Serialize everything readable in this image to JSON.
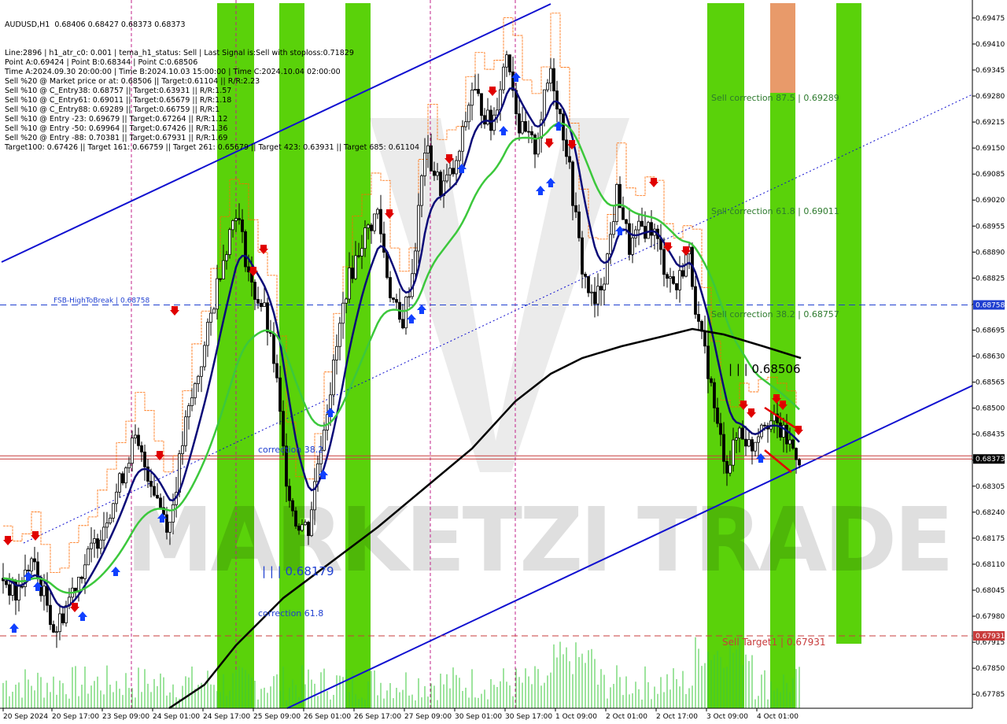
{
  "window": {
    "symbol_line": "AUDUSD,H1  0.68406 0.68427 0.68373 0.68373"
  },
  "info_lines": [
    "Line:2896 | h1_atr_c0: 0.001 | tema_h1_status: Sell | Last Signal is:Sell with stoploss:0.71829",
    "Point A:0.69424 | Point B:0.68344 | Point C:0.68506",
    "Time A:2024.09.30 20:00:00 | Time B:2024.10.03 15:00:00 | Time C:2024.10.04 02:00:00",
    "Sell %20 @ Market price or at: 0.68506 || Target:0.61104 || R/R:2.23",
    "Sell %10 @ C_Entry38: 0.68757 || Target:0.63931 || R/R:1.57",
    "Sell %10 @ C_Entry61: 0.69011 || Target:0.65679 || R/R:1.18",
    "Sell %10 @ C_Entry88: 0.69289 || Target:0.66759 || R/R:1",
    "Sell %10 @ Entry -23: 0.69679 || Target:0.67264 || R/R:1.12",
    "Sell %10 @ Entry -50: 0.69964 || Target:0.67426 || R/R:1.36",
    "Sell %20 @ Entry -88: 0.70381 || Target:0.67931 || R/R:1.69",
    "Target100: 0.67426 || Target 161: 0.66759 || Target 261: 0.65679 || Target 423: 0.63931 || Target 685: 0.61104"
  ],
  "chart_data": {
    "type": "candlestick",
    "symbol": "AUDUSD",
    "timeframe": "H1",
    "ylim": [
      0.6775,
      0.6952
    ],
    "y_ticks": [
      "0.69475",
      "0.69410",
      "0.69345",
      "0.69280",
      "0.69215",
      "0.69150",
      "0.69085",
      "0.69020",
      "0.68955",
      "0.68890",
      "0.68825",
      "0.68760",
      "0.68695",
      "0.68630",
      "0.68565",
      "0.68500",
      "0.68435",
      "0.68370",
      "0.68305",
      "0.68240",
      "0.68175",
      "0.68110",
      "0.68045",
      "0.67980",
      "0.67915",
      "0.67850",
      "0.67785"
    ],
    "x_ticks": [
      "20 Sep 2024",
      "20 Sep 17:00",
      "23 Sep 09:00",
      "24 Sep 01:00",
      "24 Sep 17:00",
      "25 Sep 09:00",
      "26 Sep 01:00",
      "26 Sep 17:00",
      "27 Sep 09:00",
      "30 Sep 01:00",
      "30 Sep 17:00",
      "1 Oct 09:00",
      "2 Oct 01:00",
      "2 Oct 17:00",
      "3 Oct 09:00",
      "4 Oct 01:00"
    ],
    "price_tags": [
      {
        "value": 0.68758,
        "label": "0.68758",
        "color": "#1f3fd0"
      },
      {
        "value": 0.68373,
        "label": "0.68373",
        "color": "#000000"
      },
      {
        "value": 0.67931,
        "label": "0.67931",
        "color": "#c83c3c"
      }
    ],
    "horizontal_levels": [
      {
        "name": "FSB-HighToBreak",
        "label": "FSB-HighToBreak | 0.68758",
        "value": 0.68758,
        "color": "#1f3fd0",
        "style": "dashed"
      },
      {
        "name": "Sell Target1",
        "label": "Sell Target1 | 0.67931",
        "value": 0.67931,
        "color": "#c83c3c",
        "style": "dashed"
      },
      {
        "name": "Current price",
        "value": 0.68373,
        "color": "#c83c3c",
        "style": "solid"
      }
    ],
    "annotations": [
      {
        "text": "Sell correction 87.5 | 0.69289",
        "value": 0.69289,
        "color": "#2d7a2d"
      },
      {
        "text": "Sell correction 61.8 | 0.69011",
        "value": 0.69011,
        "color": "#2d7a2d"
      },
      {
        "text": "Sell correction 38.2 | 0.68757",
        "value": 0.68757,
        "color": "#2d7a2d"
      },
      {
        "text": "| | | 0.68506",
        "value": 0.68506,
        "color": "#000000"
      },
      {
        "text": "correction 38.2",
        "value": 0.6841,
        "color": "#1f3fd0"
      },
      {
        "text": "| | | 0.68179",
        "value": 0.6812,
        "color": "#1f3fd0"
      },
      {
        "text": "correction 61.8",
        "value": 0.68,
        "color": "#1f3fd0"
      }
    ],
    "watermark": "MARKETZI TRADE",
    "colors": {
      "bull_bear_candle": "#000000",
      "tema_line": "#0a0a78",
      "ma_green": "#3cc83c",
      "ma_black": "#000000",
      "channel": "#1010d0",
      "highlight_band": "#5ad20a",
      "orange_band": "#e89a6a",
      "envelope": "#ff6a00",
      "sell_arrow": "#e00000",
      "buy_arrow": "#1040ff"
    }
  }
}
